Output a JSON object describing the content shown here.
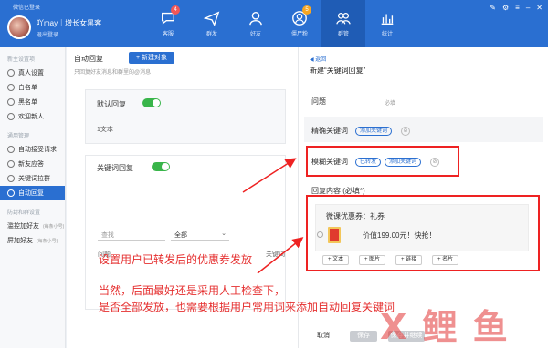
{
  "window": {
    "title": "微信已登录"
  },
  "user": {
    "name": "吖may｜增长女黑客",
    "status": "退出登录"
  },
  "nav": [
    {
      "label": "客服",
      "badge": "4"
    },
    {
      "label": "群发",
      "badge": ""
    },
    {
      "label": "好友",
      "badge": ""
    },
    {
      "label": "僵尸粉",
      "badge": "5"
    },
    {
      "label": "群管",
      "badge": ""
    },
    {
      "label": "统计",
      "badge": ""
    }
  ],
  "sidebar": {
    "section1": "新主设置项",
    "items1": [
      "真人设置",
      "白名单",
      "黑名单",
      "欢迎新人"
    ],
    "section2": "通用管理",
    "items2": [
      "自动接受请求",
      "新友应答",
      "关键词拉群",
      "自动回复"
    ],
    "section3": "防封和群设置",
    "items3": [
      {
        "label": "滥控加好友",
        "sub": "(每条小号)"
      },
      {
        "label": "屏加好友",
        "sub": "(每条小号)"
      }
    ]
  },
  "main": {
    "title": "自动回复",
    "add_button": "+ 新建对象",
    "subtitle": "只回复好友消息和群里的@消息",
    "default_reply": {
      "title": "默认回复",
      "content": "1文本"
    },
    "keyword_reply": {
      "title": "关键词回复"
    },
    "search_placeholder": "查找",
    "filter_value": "全部",
    "col_question": "问题",
    "col_keyword": "关键词"
  },
  "panel": {
    "back": "返回",
    "title": "新建“关键词回复”",
    "question_label": "问题",
    "question_value": "必填",
    "exact_label": "精确关键词",
    "exact_chip": "添加关键词",
    "fuzzy_label": "模糊关键词",
    "fuzzy_chip1": "已转发",
    "fuzzy_chip2": "添加关键词",
    "content_label": "回复内容 (必填*)",
    "coupon_title": "微课优惠券：礼券",
    "coupon_price": "价值199.00元！快抢！",
    "add_buttons": [
      "+ 文本",
      "+ 图片",
      "+ 链接",
      "+ 名片"
    ],
    "cancel": "取消",
    "save": "保存",
    "save_continue": "保存并继续"
  },
  "annotations": {
    "line1": "设置用户已转发后的优惠券发放",
    "line2a": "当然，后面最好还是采用人工检查下，",
    "line2b": "是否全部发放，也需要根据用户常用词来添加自动回复关键词"
  },
  "watermark": "X 鲤 鱼",
  "colors": {
    "brand": "#2a6fd1",
    "annotation": "#e53030",
    "toggle_on": "#39b54a"
  }
}
